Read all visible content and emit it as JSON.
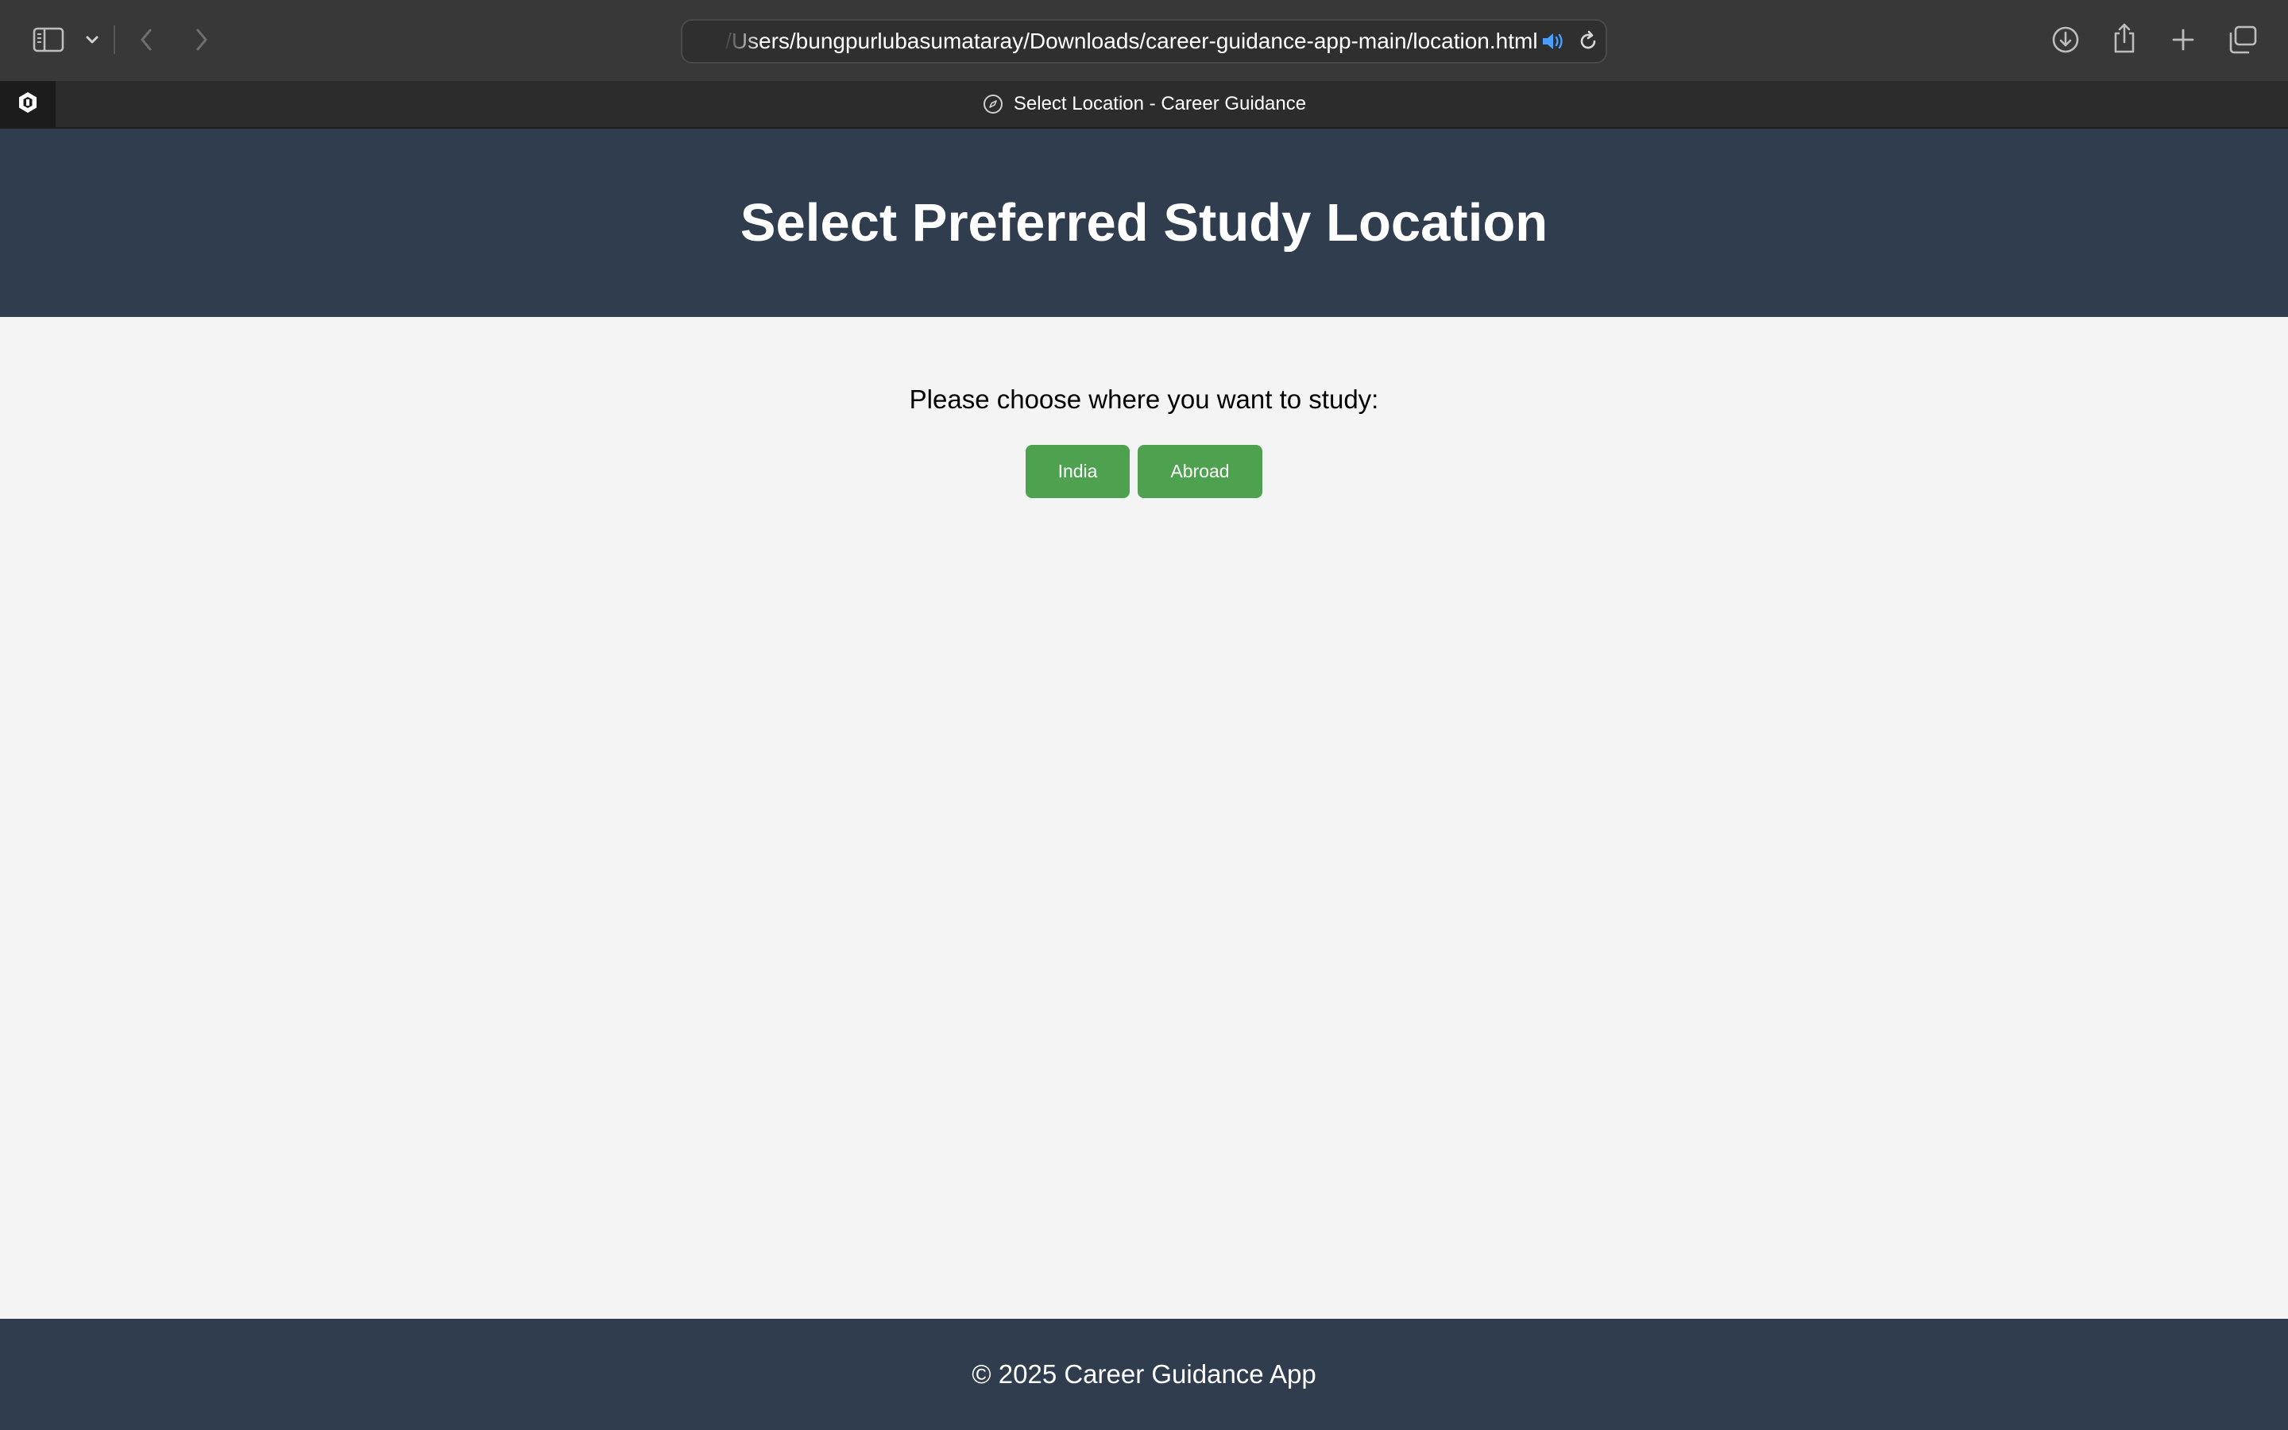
{
  "browser": {
    "url": "/Users/bungpurlubasumataray/Downloads/career-guidance-app-main/location.html",
    "tab_title": "Select Location - Career Guidance",
    "icons": {
      "sidebar": "sidebar-icon",
      "sidebar_menu": "chevron-down-icon",
      "back": "chevron-left-icon",
      "forward": "chevron-right-icon",
      "audio": "speaker-icon",
      "reload": "reload-icon",
      "downloads": "download-icon",
      "share": "share-icon",
      "new_tab": "plus-icon",
      "tab_overview": "tabs-overview-icon",
      "pinned_tab": "pinned-site-icon",
      "tab_favicon": "compass-icon"
    },
    "accent_color": "#4a9eff"
  },
  "page": {
    "title": "Select Preferred Study Location",
    "prompt": "Please choose where you want to study:",
    "buttons": {
      "india": "India",
      "abroad": "Abroad"
    },
    "footer": "© 2025 Career Guidance App",
    "colors": {
      "header_bg": "#2f3d4f",
      "button_bg": "#4ea14f",
      "page_bg": "#f4f4f4"
    }
  }
}
